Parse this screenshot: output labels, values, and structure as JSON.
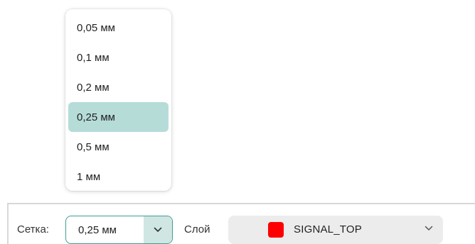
{
  "grid_dropdown": {
    "options": [
      "0,05 мм",
      "0,1 мм",
      "0,2 мм",
      "0,25 мм",
      "0,5 мм",
      "1 мм"
    ],
    "selected_index": 3
  },
  "toolbar": {
    "grid_label": "Сетка:",
    "grid_value": "0,25 мм",
    "layer_label": "Слой",
    "layer_value": "SIGNAL_TOP",
    "layer_color": "#ff0000"
  },
  "colors": {
    "accent": "#3e9e95",
    "selected_option_bg": "#b6dcd8",
    "caret_bg": "#cfe6e3"
  },
  "icons": {
    "grid_caret": "chevron-down-icon",
    "layer_caret": "chevron-down-icon"
  }
}
